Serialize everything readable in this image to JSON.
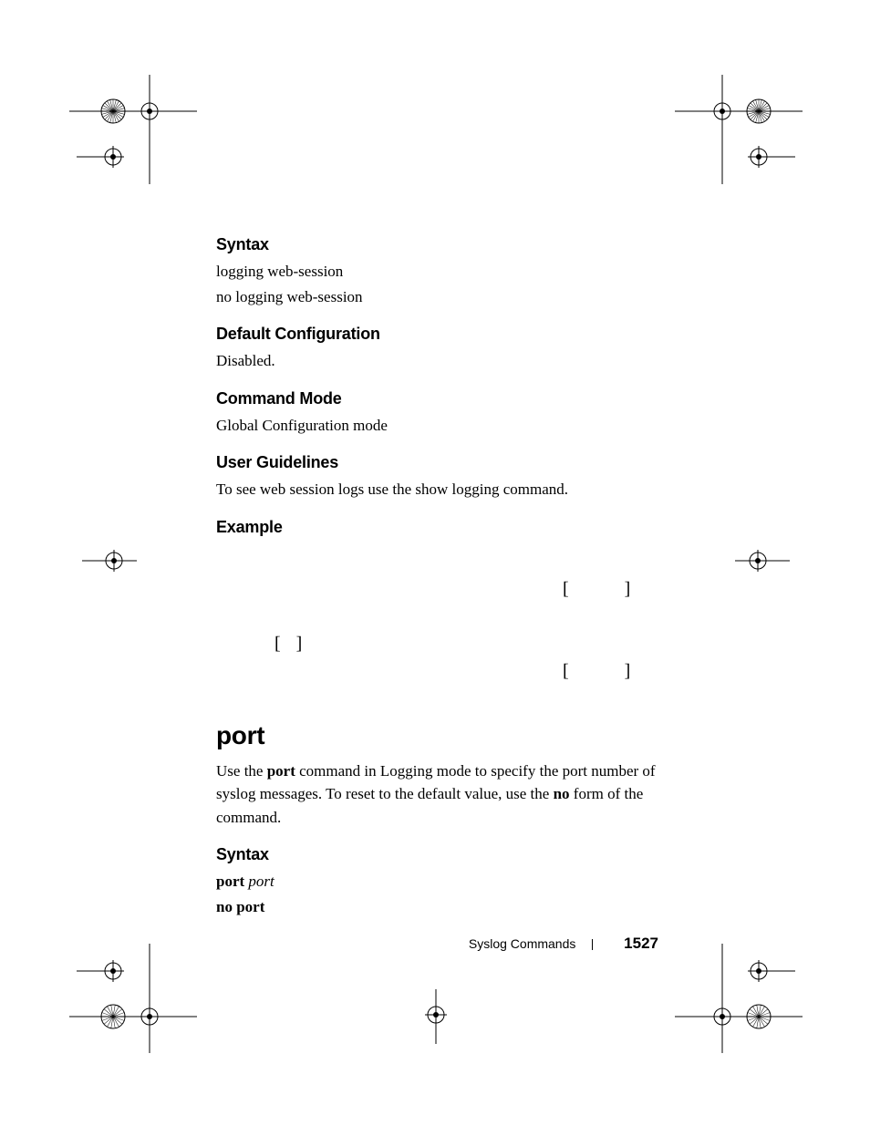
{
  "sections": {
    "syntax1": {
      "heading": "Syntax",
      "line1": "logging web-session",
      "line2": "no logging web-session"
    },
    "defaultconfig": {
      "heading": "Default Configuration",
      "body": "Disabled."
    },
    "commandmode": {
      "heading": "Command Mode",
      "body": "Global Configuration mode"
    },
    "userguidelines": {
      "heading": "User Guidelines",
      "body": "To see web session logs use the show logging command."
    },
    "example": {
      "heading": "Example",
      "bracket_top": "[          ]",
      "bracket_mid": "[  ]",
      "bracket_bot": "[          ]"
    },
    "cmd": {
      "title": "port",
      "desc_prefix": "Use the ",
      "desc_bold1": "port",
      "desc_mid": " command in Logging mode to specify the port number of syslog messages. To reset to the default value, use the ",
      "desc_bold2": "no",
      "desc_suffix": " form of the command."
    },
    "syntax2": {
      "heading": "Syntax",
      "cmd_bold": "port",
      "cmd_ital": "port",
      "neg": "no port"
    }
  },
  "footer": {
    "section": "Syslog Commands",
    "page": "1527"
  }
}
